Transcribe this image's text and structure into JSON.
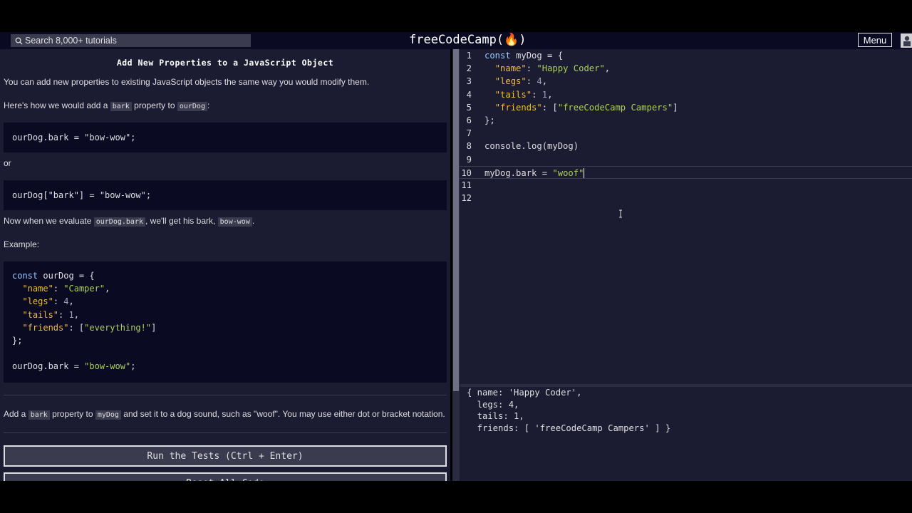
{
  "header": {
    "search_placeholder": "Search 8,000+ tutorials",
    "brand": "freeCodeCamp(🔥)",
    "menu_label": "Menu"
  },
  "lesson": {
    "title": "Add New Properties to a JavaScript Object",
    "intro": "You can add new properties to existing JavaScript objects the same way you would modify them.",
    "p2_pre": "Here's how we would add a ",
    "p2_code1": "bark",
    "p2_mid": " property to ",
    "p2_code2": "ourDog",
    "p2_post": ":",
    "example1": "ourDog.bark = \"bow-wow\";",
    "or": "or",
    "example2": "ourDog[\"bark\"] = \"bow-wow\";",
    "p3_pre": "Now when we evaluate ",
    "p3_code1": "ourDog.bark",
    "p3_mid": ", we'll get his bark, ",
    "p3_code2": "bow-wow",
    "p3_post": ".",
    "example_label": "Example:",
    "task_pre": "Add a ",
    "task_code1": "bark",
    "task_mid": " property to ",
    "task_code2": "myDog",
    "task_post": " and set it to a dog sound, such as \"woof\". You may use either dot or bracket notation.",
    "run_button": "Run the Tests (Ctrl + Enter)",
    "reset_button": "Reset All Code"
  },
  "example_code": [
    "const ourDog = {",
    "  \"name\": \"Camper\",",
    "  \"legs\": 4,",
    "  \"tails\": 1,",
    "  \"friends\": [\"everything!\"]",
    "};",
    "",
    "ourDog.bark = \"bow-wow\";"
  ],
  "editor": {
    "line_numbers": [
      "1",
      "2",
      "3",
      "4",
      "5",
      "6",
      "7",
      "8",
      "9",
      "10",
      "11",
      "12"
    ],
    "lines": [
      "const myDog = {",
      "  \"name\": \"Happy Coder\",",
      "  \"legs\": 4,",
      "  \"tails\": 1,",
      "  \"friends\": [\"freeCodeCamp Campers\"]",
      "};",
      "",
      "console.log(myDog)",
      "",
      "myDog.bark = \"woof\"",
      "",
      ""
    ],
    "active_line": 10
  },
  "console": {
    "lines": [
      "{ name: 'Happy Coder',",
      "  legs: 4,",
      "  tails: 1,",
      "  friends: [ 'freeCodeCamp Campers' ] }"
    ]
  },
  "colors": {
    "nav_bg": "#0a0a23",
    "panel_bg": "#1b1b32",
    "code_bg": "#0a0a23",
    "inline_code_bg": "#3b3b4f",
    "keyword": "#99c9ff",
    "string": "#acd157",
    "property": "#f1be32"
  }
}
